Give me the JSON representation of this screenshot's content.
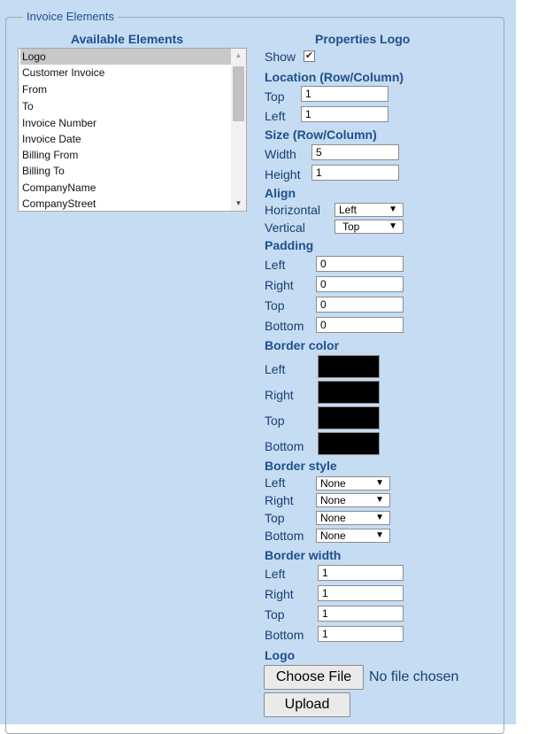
{
  "fieldset_legend": "Invoice Elements",
  "available": {
    "heading": "Available Elements",
    "items": [
      "Logo",
      "Customer Invoice",
      "From",
      "To",
      "Invoice Number",
      "Invoice Date",
      "Billing From",
      "Billing To",
      "CompanyName",
      "CompanyStreet"
    ],
    "selected": "Logo"
  },
  "properties": {
    "heading": "Properties Logo",
    "show_label": "Show",
    "show_checked": true,
    "location_heading": "Location (Row/Column)",
    "top_label": "Top",
    "top_value": "1",
    "left_label": "Left",
    "left_value": "1",
    "size_heading": "Size (Row/Column)",
    "width_label": "Width",
    "width_value": "5",
    "height_label": "Height",
    "height_value": "1",
    "align_heading": "Align",
    "horizontal_label": "Horizontal",
    "horizontal_value": "Left",
    "vertical_label": "Vertical",
    "vertical_value": "Top",
    "padding_heading": "Padding",
    "padding": {
      "left_label": "Left",
      "left": "0",
      "right_label": "Right",
      "right": "0",
      "top_label": "Top",
      "top": "0",
      "bottom_label": "Bottom",
      "bottom": "0"
    },
    "border_color_heading": "Border color",
    "border_color": {
      "left_label": "Left",
      "right_label": "Right",
      "top_label": "Top",
      "bottom_label": "Bottom",
      "color": "#000000"
    },
    "border_style_heading": "Border style",
    "border_style": {
      "left_label": "Left",
      "left": "None",
      "right_label": "Right",
      "right": "None",
      "top_label": "Top",
      "top": "None",
      "bottom_label": "Bottom",
      "bottom": "None"
    },
    "border_width_heading": "Border width",
    "border_width": {
      "left_label": "Left",
      "left": "1",
      "right_label": "Right",
      "right": "1",
      "top_label": "Top",
      "top": "1",
      "bottom_label": "Bottom",
      "bottom": "1"
    },
    "logo_heading": "Logo",
    "choose_file_label": "Choose File",
    "no_file_text": "No file chosen",
    "upload_label": "Upload"
  },
  "icons": {
    "dropdown_arrow": "▼",
    "scroll_up": "▲",
    "scroll_down": "▼",
    "check": "✔"
  }
}
